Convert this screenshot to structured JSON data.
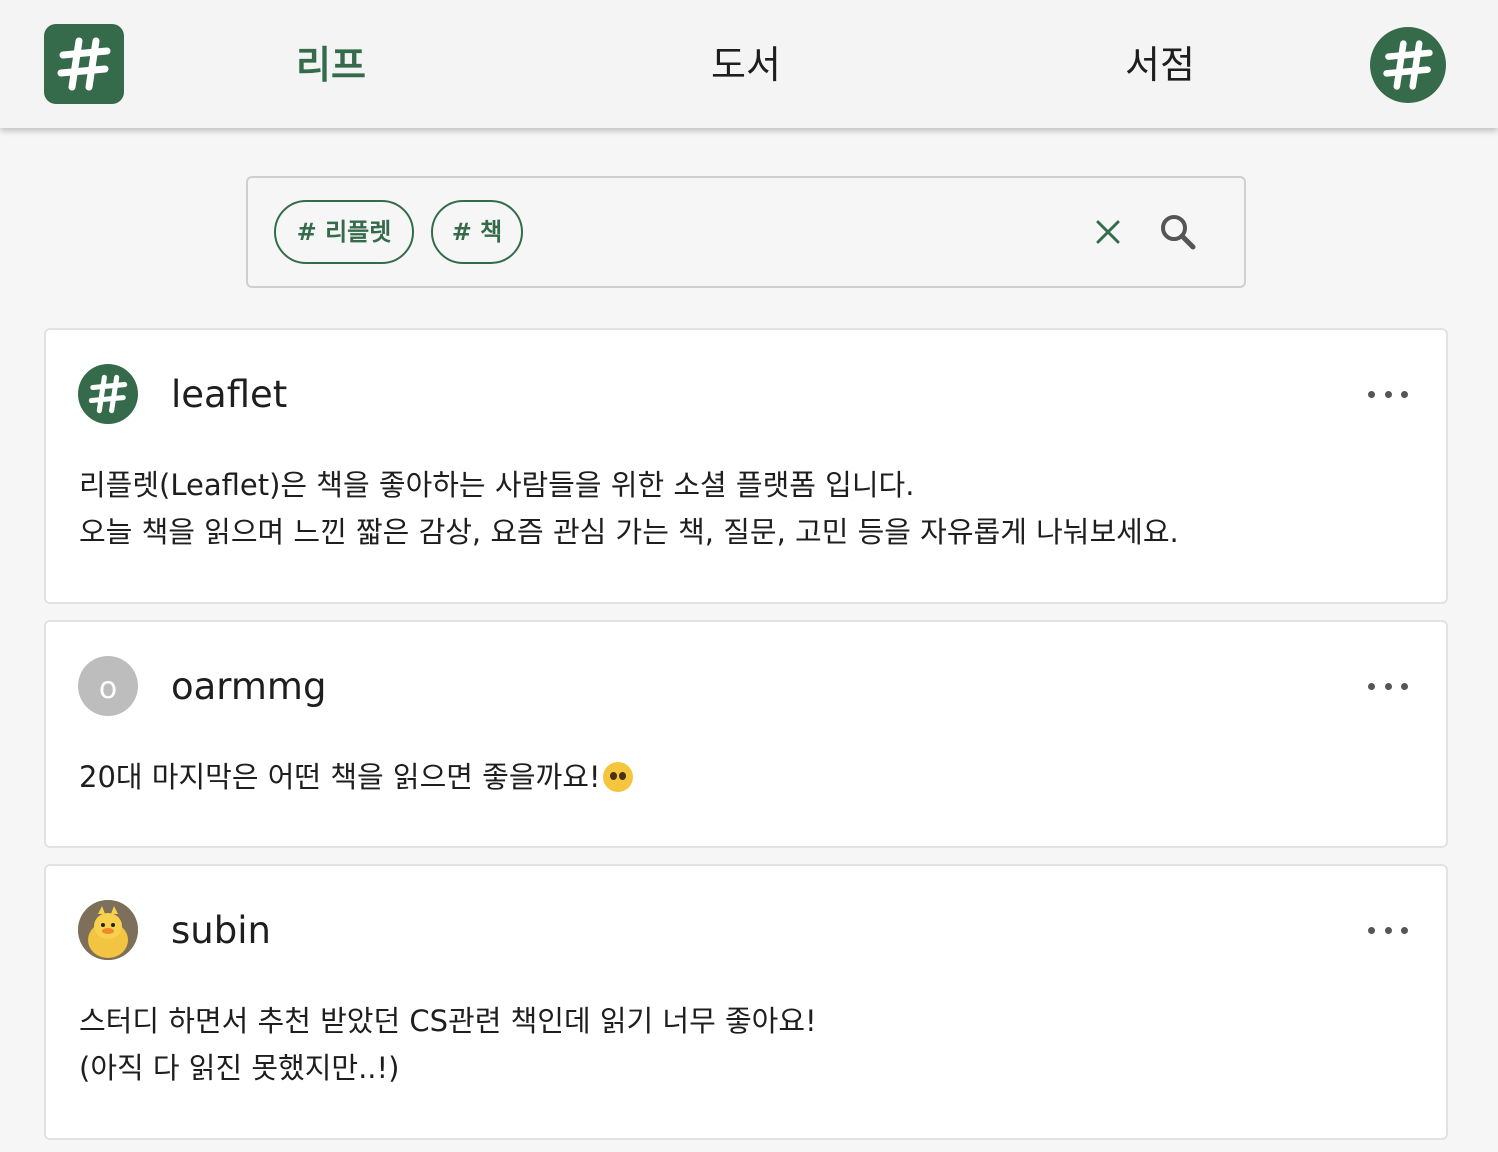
{
  "header": {
    "tabs": [
      {
        "label": "리프",
        "active": true
      },
      {
        "label": "도서",
        "active": false
      },
      {
        "label": "서점",
        "active": false
      }
    ],
    "logo_icon": "hashtag-icon",
    "brand_color": "#356b4b"
  },
  "search": {
    "tags": [
      "# 리플렛",
      "# 책"
    ],
    "clear_icon": "close-icon",
    "search_icon": "search-icon"
  },
  "posts": [
    {
      "username": "leaflet",
      "avatar": "hashtag-icon",
      "lines": [
        "리플렛(Leaflet)은 책을 좋아하는 사람들을 위한 소셜 플랫폼 입니다.",
        "오늘 책을 읽으며 느낀 짧은 감상, 요즘 관심 가는 책, 질문, 고민 등을 자유롭게 나눠보세요."
      ]
    },
    {
      "username": "oarmmg",
      "avatar_letter": "o",
      "lines": [
        "20대 마지막은 어떤 책을 읽으면 좋을까요!"
      ],
      "emoji": "pleading-face-emoji"
    },
    {
      "username": "subin",
      "avatar": "duck-photo",
      "lines": [
        "스터디 하면서 추천 받았던 CS관련 책인데 읽기 너무 좋아요!",
        "(아직 다 읽진 못했지만..!)"
      ]
    }
  ]
}
